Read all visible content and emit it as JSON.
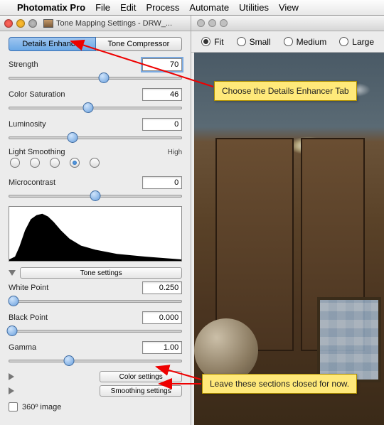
{
  "menubar": {
    "app": "Photomatix Pro",
    "items": [
      "File",
      "Edit",
      "Process",
      "Automate",
      "Utilities",
      "View"
    ]
  },
  "window": {
    "title": "Tone Mapping Settings - DRW_..."
  },
  "tabs": {
    "details": "Details Enhancer",
    "compressor": "Tone Compressor"
  },
  "controls": {
    "strength": {
      "label": "Strength",
      "value": "70",
      "pos": 55
    },
    "color_sat": {
      "label": "Color Saturation",
      "value": "46",
      "pos": 46
    },
    "luminosity": {
      "label": "Luminosity",
      "value": "0",
      "pos": 37
    },
    "light_smoothing": {
      "label": "Light Smoothing",
      "high": "High",
      "selected": 3
    },
    "microcontrast": {
      "label": "Microcontrast",
      "value": "0",
      "pos": 50
    },
    "white_point": {
      "label": "White Point",
      "value": "0.250",
      "pos": 3
    },
    "black_point": {
      "label": "Black Point",
      "value": "0.000",
      "pos": 2
    },
    "gamma": {
      "label": "Gamma",
      "value": "1.00",
      "pos": 35
    }
  },
  "sections": {
    "tone": "Tone settings",
    "color": "Color settings",
    "smoothing": "Smoothing settings"
  },
  "checkbox": {
    "label": "360º image"
  },
  "fit_options": {
    "fit": "Fit",
    "small": "Small",
    "medium": "Medium",
    "large": "Large"
  },
  "annotations": {
    "tab_note": "Choose the Details Enhancer Tab",
    "sections_note": "Leave these sections closed for now."
  }
}
